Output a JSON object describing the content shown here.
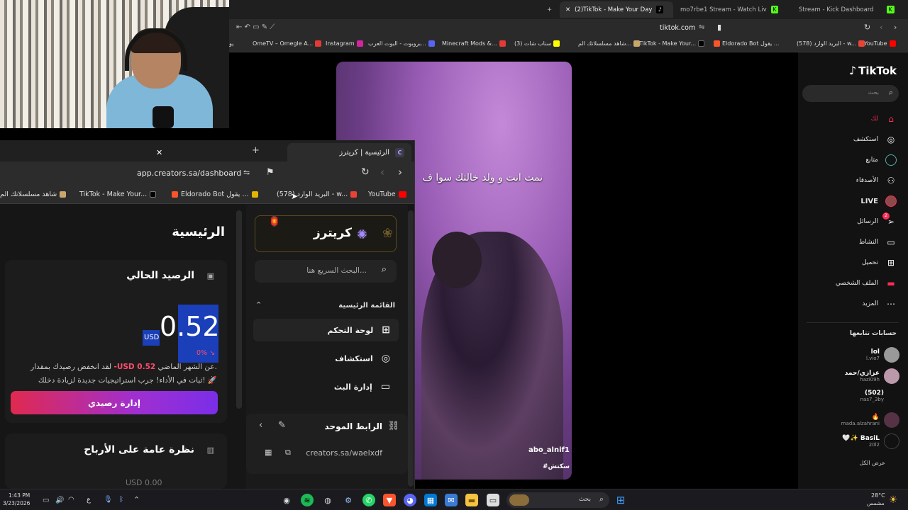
{
  "webcam": {},
  "tiktok_browser": {
    "tabs": [
      {
        "label": "(2)TikTok - Make Your Day",
        "active": true
      },
      {
        "label": "mo7rbe1 Stream - Watch Live on Kick",
        "active": false
      },
      {
        "label": "Stream - Kick Dashboard",
        "active": false
      }
    ],
    "address": "tiktok.com",
    "bookmarks": [
      "YouTube",
      "البريد الوارد (578) - w...",
      "Eldorado Bot يقول ...",
      "TikTok - Make Your...",
      "شاهد مسلسلاتك الم...",
      "(3) سناب شات",
      "Minecraft Mods &...",
      "بروبوت - البوت العرب...",
      "Instagram",
      "OmeTV – Omegle A...",
      "يو"
    ]
  },
  "tiktok": {
    "logo": "TikTok",
    "search_placeholder": "بحث",
    "nav": [
      {
        "label": "لك",
        "icon": "home-icon"
      },
      {
        "label": "استكشف",
        "icon": "compass-icon"
      },
      {
        "label": "متابع",
        "icon": "following-icon"
      },
      {
        "label": "الأصدقاء",
        "icon": "friends-icon"
      },
      {
        "label": "LIVE",
        "icon": "live-avatar-icon"
      },
      {
        "label": "الرسائل",
        "icon": "messages-icon",
        "badge": "2"
      },
      {
        "label": "النشاط",
        "icon": "activity-icon"
      },
      {
        "label": "تحميل",
        "icon": "upload-icon"
      },
      {
        "label": "الملف الشخصي",
        "icon": "profile-icon"
      },
      {
        "label": "المزيد",
        "icon": "more-icon"
      }
    ],
    "following_title": "حسابات تتابعها",
    "following": [
      {
        "name": "lol",
        "handle": "l.vio7"
      },
      {
        "name": "عزازي/حمد",
        "handle": "hazi09h"
      },
      {
        "name": "(502)",
        "handle": "nas7_3by"
      },
      {
        "name": "🔥",
        "handle": "mada.alzahrani"
      },
      {
        "name": "🤍✨ BasiL",
        "handle": "20l2"
      }
    ],
    "see_all": "عرض الكل",
    "video": {
      "caption": "نمت انت و ولد خالتك سوا ف",
      "username": "abo_alnif1",
      "hashtag": "#سكتش"
    }
  },
  "creators_browser": {
    "tab_title": "الرئيسية | كريترز",
    "url": "app.creators.sa/dashboard",
    "bookmarks": [
      "YouTube",
      "البريد الوارد (578) - w...",
      "Eldorado Bot يقول ...",
      "TikTok - Make Your...",
      "شاهد مسلسلاتك الم"
    ]
  },
  "creators": {
    "brand": "كريترز",
    "search_placeholder": "البحث السريع هنا...",
    "menu_title": "القائمة الرئيسية",
    "menu": [
      {
        "label": "لوحة التحكم",
        "icon": "dashboard-icon",
        "active": true
      },
      {
        "label": "استكشاف",
        "icon": "compass-icon",
        "active": false
      },
      {
        "label": "إدارة البث",
        "icon": "video-icon",
        "active": false
      }
    ],
    "link_title": "الرابط الموحد",
    "link_value": "creators.sa/waelxdf",
    "page_title": "الرئيسية",
    "balance": {
      "label": "الرصيد الحالي",
      "amount": "0.52",
      "currency": "USD",
      "change": "0% ↘",
      "msg_line1_a": "لقد انخفض رصيدك بمقدار ",
      "msg_line1_value": "-USD 0.52",
      "msg_line1_b": " عن الشهر الماضي.",
      "msg_line2": "ثبات في الأداء! جرب استراتيجيات جديدة لزيادة دخلك! 🚀",
      "button": "إدارة رصيدي"
    },
    "earnings": {
      "title": "نظرة عامة على الأرباح",
      "value": "USD 0.00"
    }
  },
  "taskbar": {
    "time": "1:43 PM",
    "date": "3/23/2026",
    "lang": "ع",
    "search": "بحث",
    "weather_temp": "28°C",
    "weather_desc": "مشمس"
  },
  "colors": {
    "tiktok_red": "#fe2c55",
    "creators_gradient_start": "#e0294f",
    "creators_gradient_end": "#7b2ee8",
    "balance_highlight": "#1a3fb8"
  }
}
